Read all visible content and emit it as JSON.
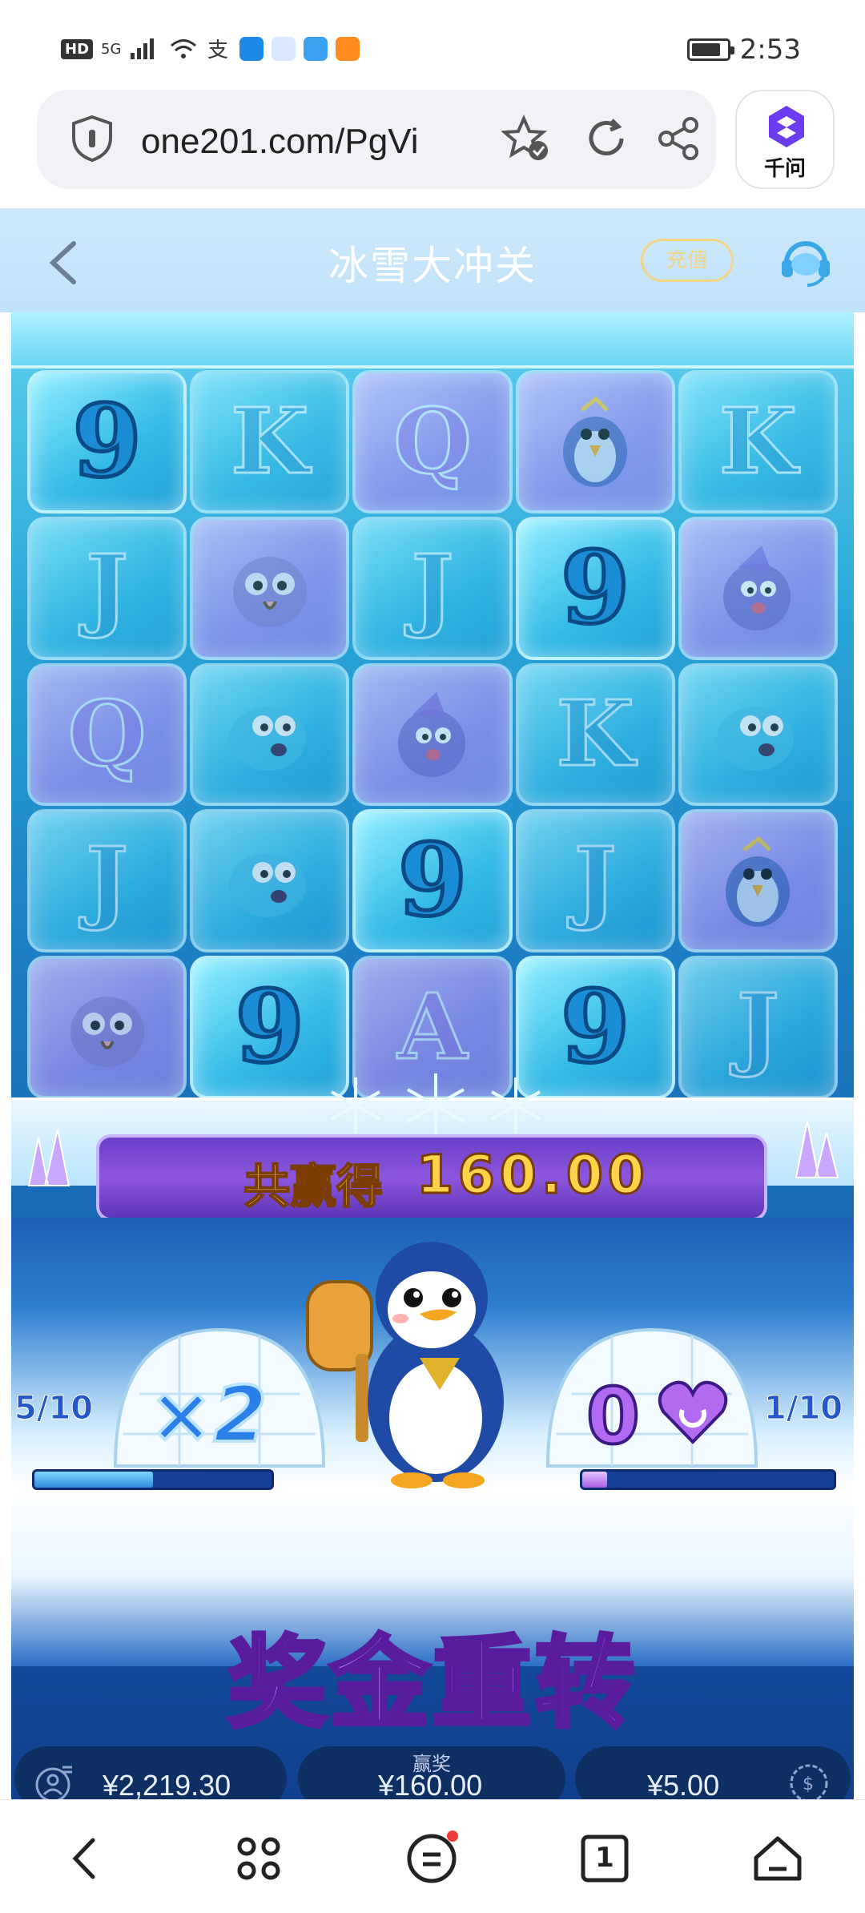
{
  "status_bar": {
    "hd_badge": "HD",
    "signal": "5G",
    "time": "2:53",
    "battery_level": 0.85
  },
  "browser": {
    "url": "one201.com/PgVi",
    "ai_button_label": "千问"
  },
  "game_header": {
    "title": "冰雪大冲关",
    "recharge_label": "充值"
  },
  "reels": {
    "rows": [
      [
        "9",
        "K",
        "Q",
        "penguin-chick",
        "K"
      ],
      [
        "J",
        "owl",
        "J",
        "9",
        "puffin"
      ],
      [
        "Q",
        "pufferfish",
        "puffin",
        "K",
        "pufferfish"
      ],
      [
        "J",
        "pufferfish",
        "9",
        "J",
        "penguin-chick"
      ],
      [
        "owl",
        "9",
        "A",
        "9",
        "J"
      ]
    ]
  },
  "win_banner": {
    "label": "共赢得",
    "amount": "160.00"
  },
  "bonus_meters": {
    "left_count": "5/10",
    "left_progress": 0.5,
    "multiplier": "×2",
    "right_value": "0",
    "right_count": "1/10",
    "right_progress": 0.1
  },
  "bonus_title": "奖金重转",
  "bottom_bar": {
    "balance": "¥2,219.30",
    "win_caption": "赢奖",
    "win_amount": "¥160.00",
    "bet": "¥5.00"
  },
  "nav": {
    "tab_count": "1"
  },
  "colors": {
    "header_bg": "#cfe9fb",
    "win_gold": "#ffd34a",
    "bonus_purple": "#b56cff",
    "meter_blue": "#2a7fe8"
  }
}
